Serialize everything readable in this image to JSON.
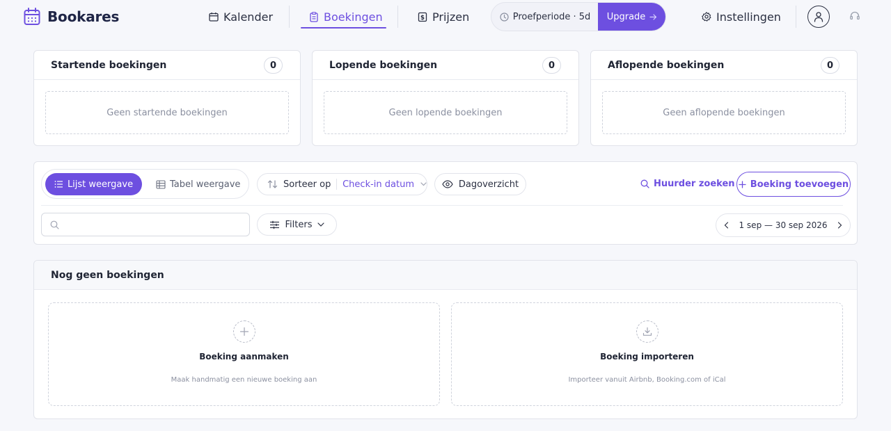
{
  "app": {
    "name": "Bookares"
  },
  "nav": [
    {
      "label": "Kalender",
      "active": false,
      "icon": "calendar-icon"
    },
    {
      "label": "Boekingen",
      "active": true,
      "icon": "clipboard-icon"
    },
    {
      "label": "Prijzen",
      "active": false,
      "icon": "price-tag-icon"
    }
  ],
  "trial": {
    "label": "Proefperiode · 5d",
    "upgrade_label": "Upgrade"
  },
  "settings_label": "Instellingen",
  "summary": [
    {
      "title": "Startende boekingen",
      "count": "0",
      "empty_text": "Geen startende boekingen"
    },
    {
      "title": "Lopende boekingen",
      "count": "0",
      "empty_text": "Geen lopende boekingen"
    },
    {
      "title": "Aflopende boekingen",
      "count": "0",
      "empty_text": "Geen aflopende boekingen"
    }
  ],
  "toolbar": {
    "list_view_label": "Lijst weergave",
    "table_view_label": "Tabel weergave",
    "sort_label": "Sorteer op",
    "sort_value": "Check-in datum",
    "day_overview_label": "Dagoverzicht",
    "tenant_search_label": "Huurder zoeken",
    "add_booking_label": "Boeking toevoegen",
    "search_value": "",
    "search_placeholder": "",
    "filters_label": "Filters",
    "date_range": "1 sep — 30 sep 2026"
  },
  "empty": {
    "title": "Nog geen boekingen",
    "create_title": "Boeking aanmaken",
    "create_desc": "Maak handmatig een nieuwe boeking aan",
    "import_title": "Boeking importeren",
    "import_desc": "Importeer vanuit Airbnb, Booking.com of iCal"
  },
  "colors": {
    "accent": "#6d4fe0",
    "background": "#f6f7fb",
    "border": "#e1e3ea",
    "text": "#1f2433",
    "muted": "#8b90a0"
  }
}
